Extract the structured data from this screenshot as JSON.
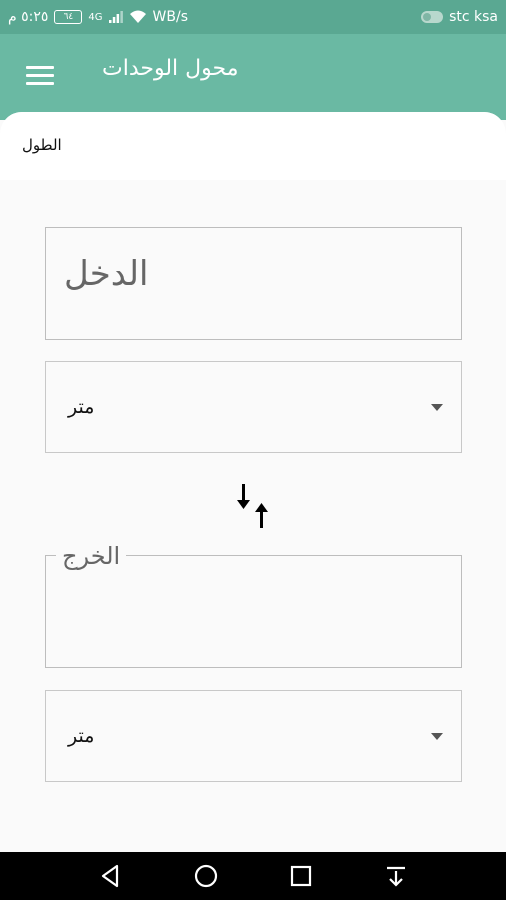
{
  "status_bar": {
    "carrier": "stc ksa",
    "speed": "WB/s",
    "battery": "٦٤",
    "time": "٥:٢٥ م",
    "signal": "4G"
  },
  "app_bar": {
    "title": "محول الوحدات"
  },
  "tab": {
    "label": "الطول"
  },
  "input": {
    "placeholder": "الدخل"
  },
  "from_unit": {
    "selected": "متر"
  },
  "output": {
    "label": "الخرج"
  },
  "to_unit": {
    "selected": "متر"
  },
  "icons": {
    "menu": "hamburger-menu-icon",
    "swap": "swap-vertical-icon",
    "back": "nav-back-icon",
    "home": "nav-home-icon",
    "recents": "nav-recents-icon",
    "notifications": "nav-pulldown-icon"
  },
  "colors": {
    "status_bar": "#5aa892",
    "app_bar": "#6ab9a3",
    "background": "#fafafa",
    "nav_bar": "#000000"
  }
}
